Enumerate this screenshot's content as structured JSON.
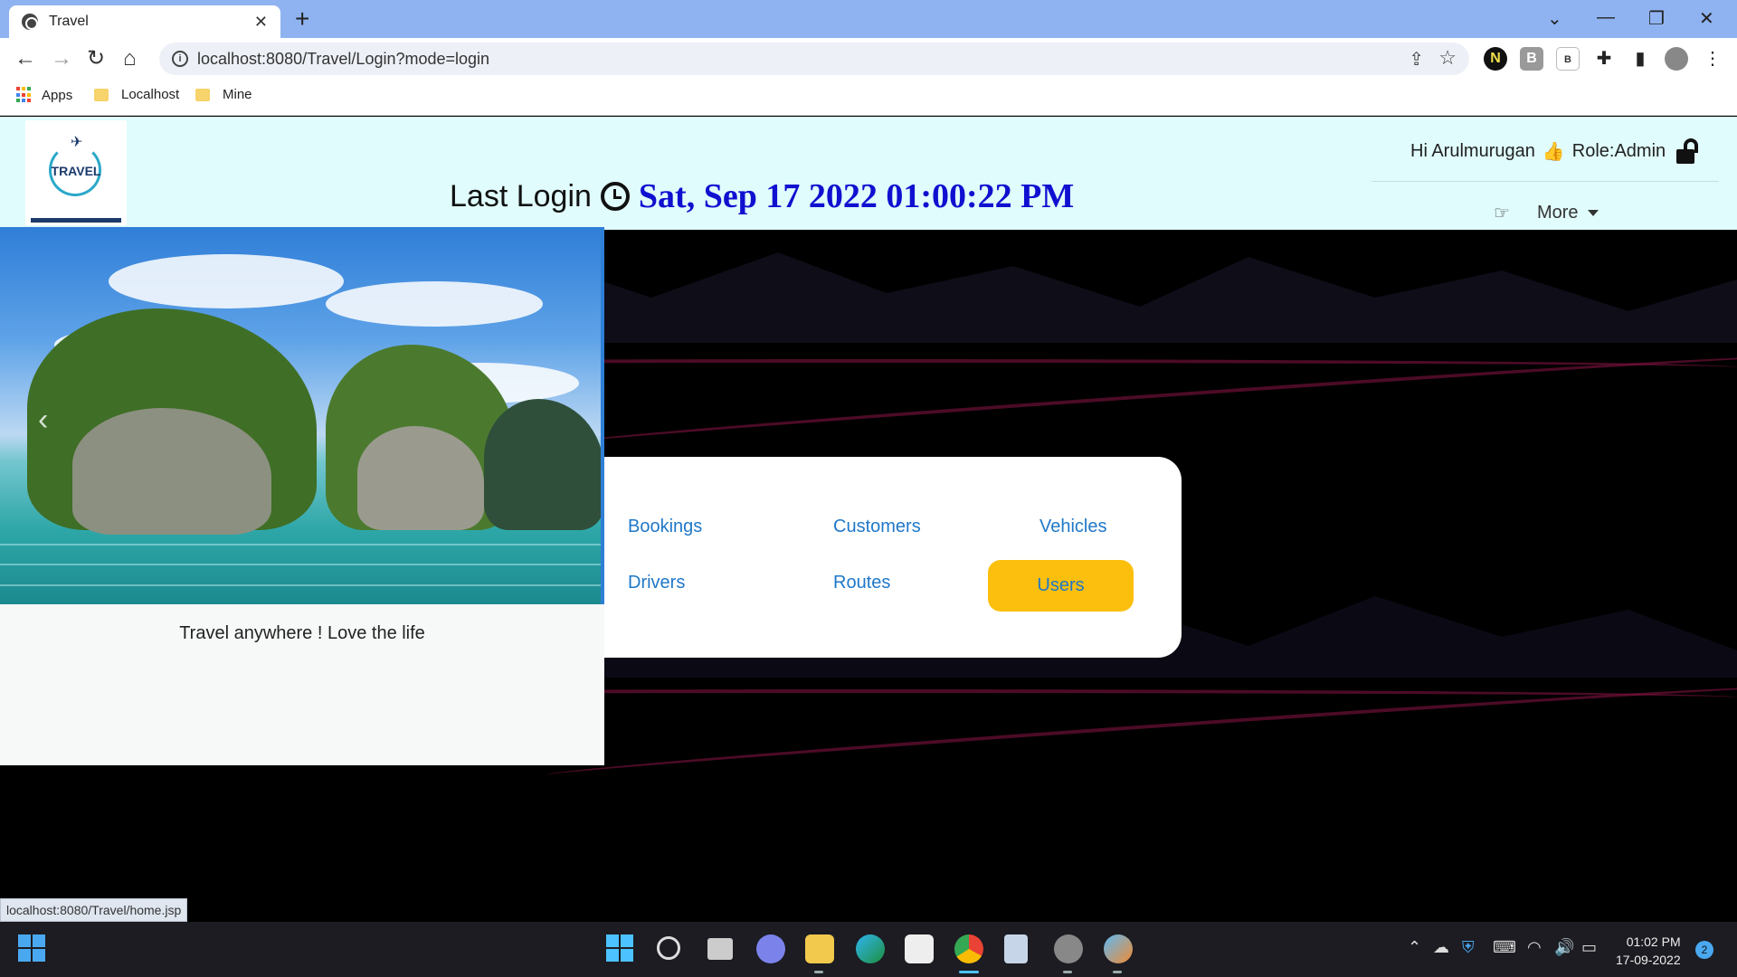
{
  "browser": {
    "tab_title": "Travel",
    "tab_close": "✕",
    "new_tab": "+",
    "url": "localhost:8080/Travel/Login?mode=login",
    "bookmarks": [
      {
        "label": "Apps"
      },
      {
        "label": "Localhost"
      },
      {
        "label": "Mine"
      }
    ],
    "status_url": "localhost:8080/Travel/home.jsp"
  },
  "header": {
    "logo_text": "TRAVEL",
    "last_login_label": "Last Login",
    "last_login_value": "Sat, Sep 17 2022 01:00:22 PM",
    "greeting": "Hi Arulmurugan",
    "role": "Role:Admin",
    "more_label": "More"
  },
  "carousel": {
    "caption": "Travel anywhere ! Love the life"
  },
  "menu": {
    "items": [
      {
        "label": "Bookings"
      },
      {
        "label": "Customers"
      },
      {
        "label": "Vehicles"
      },
      {
        "label": "Drivers"
      },
      {
        "label": "Routes"
      },
      {
        "label": "Users"
      }
    ],
    "accent_color": "#fcbf0e",
    "link_color": "#1f78c8"
  },
  "taskbar": {
    "time": "01:02 PM",
    "date": "17-09-2022",
    "notification_count": "2"
  },
  "colors": {
    "header_bg": "#e0fcfc",
    "last_login_value": "#1010d0",
    "tabbar_bg": "#8fb3f0"
  }
}
